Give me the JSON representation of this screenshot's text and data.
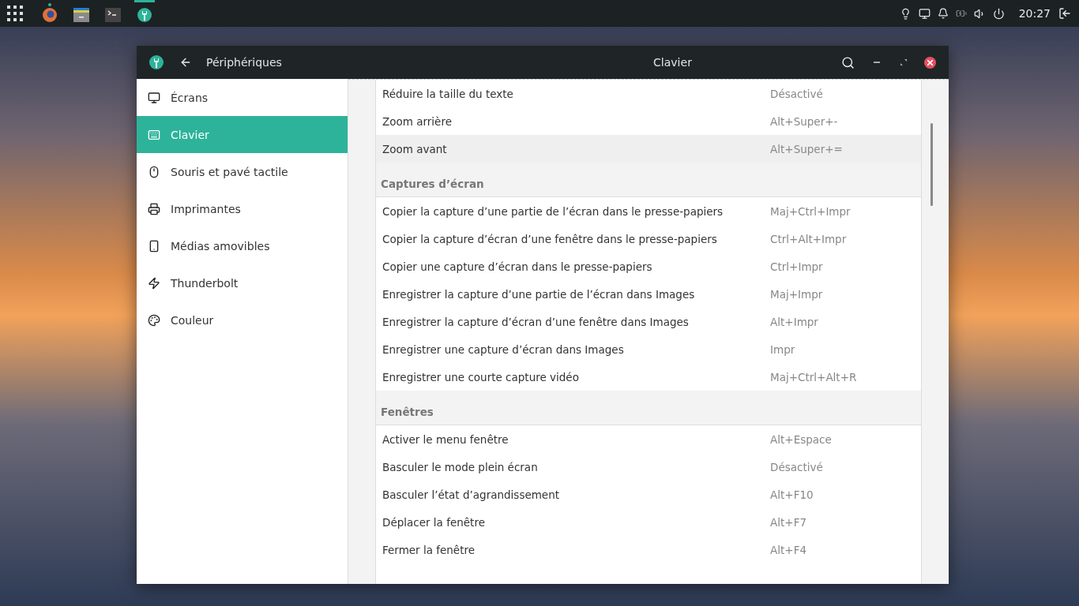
{
  "top_bar": {
    "apps": [
      {
        "kind": "browser",
        "running": true,
        "active": false
      },
      {
        "kind": "files",
        "running": false,
        "active": false
      },
      {
        "kind": "terminal",
        "running": false,
        "active": false
      },
      {
        "kind": "settings",
        "running": true,
        "active": true
      }
    ],
    "clock": "20:27"
  },
  "window": {
    "back_label": "Périphériques",
    "title": "Clavier"
  },
  "sidebar": {
    "items": [
      {
        "kind": "displays",
        "label": "Écrans",
        "selected": false
      },
      {
        "kind": "keyboard",
        "label": "Clavier",
        "selected": true
      },
      {
        "kind": "mouse",
        "label": "Souris et pavé tactile",
        "selected": false
      },
      {
        "kind": "printer",
        "label": "Imprimantes",
        "selected": false
      },
      {
        "kind": "media",
        "label": "Médias amovibles",
        "selected": false
      },
      {
        "kind": "thunderbolt",
        "label": "Thunderbolt",
        "selected": false
      },
      {
        "kind": "color",
        "label": "Couleur",
        "selected": false
      }
    ]
  },
  "sections": [
    {
      "rows": [
        {
          "action": "Réduire la taille du texte",
          "shortcut": "Désactivé",
          "selected": false
        },
        {
          "action": "Zoom arrière",
          "shortcut": "Alt+Super+-",
          "selected": false
        },
        {
          "action": "Zoom avant",
          "shortcut": "Alt+Super+=",
          "selected": true
        }
      ]
    },
    {
      "title": "Captures d’écran",
      "rows": [
        {
          "action": "Copier la capture d’une partie de l’écran dans le presse-papiers",
          "shortcut": "Maj+Ctrl+Impr",
          "selected": false
        },
        {
          "action": "Copier la capture d’écran d’une fenêtre dans le presse-papiers",
          "shortcut": "Ctrl+Alt+Impr",
          "selected": false
        },
        {
          "action": "Copier une capture d’écran dans le presse-papiers",
          "shortcut": "Ctrl+Impr",
          "selected": false
        },
        {
          "action": "Enregistrer la capture d’une partie de l’écran dans Images",
          "shortcut": "Maj+Impr",
          "selected": false
        },
        {
          "action": "Enregistrer la capture d’écran d’une fenêtre dans Images",
          "shortcut": "Alt+Impr",
          "selected": false
        },
        {
          "action": "Enregistrer une capture d’écran dans Images",
          "shortcut": "Impr",
          "selected": false
        },
        {
          "action": "Enregistrer une courte capture vidéo",
          "shortcut": "Maj+Ctrl+Alt+R",
          "selected": false
        }
      ]
    },
    {
      "title": "Fenêtres",
      "rows": [
        {
          "action": "Activer le menu fenêtre",
          "shortcut": "Alt+Espace",
          "selected": false
        },
        {
          "action": "Basculer le mode plein écran",
          "shortcut": "Désactivé",
          "selected": false
        },
        {
          "action": "Basculer l’état d’agrandissement",
          "shortcut": "Alt+F10",
          "selected": false
        },
        {
          "action": "Déplacer la fenêtre",
          "shortcut": "Alt+F7",
          "selected": false
        },
        {
          "action": "Fermer la fenêtre",
          "shortcut": "Alt+F4",
          "selected": false
        }
      ]
    }
  ]
}
